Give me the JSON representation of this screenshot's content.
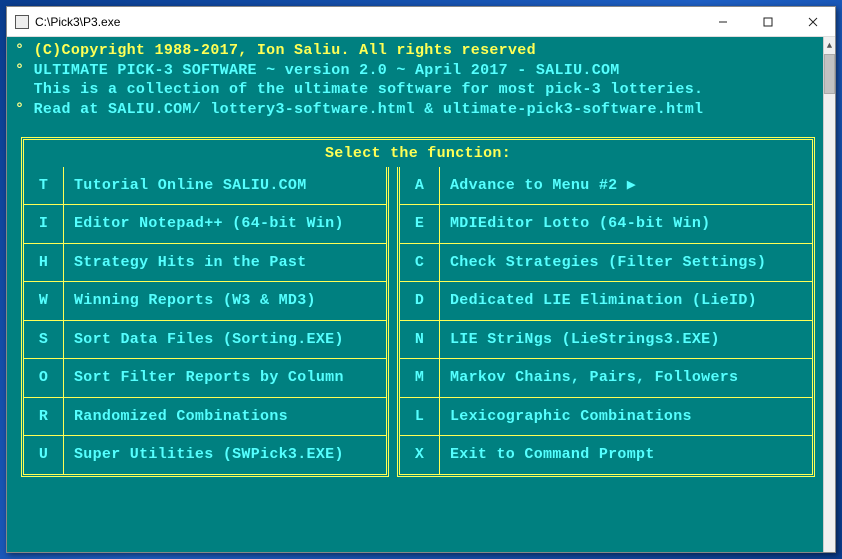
{
  "window": {
    "title": "C:\\Pick3\\P3.exe"
  },
  "header": {
    "line1": "(C)Copyright 1988-2017, Ion Saliu. All rights reserved",
    "line2": "ULTIMATE PICK-3 SOFTWARE ~ version 2.0 ~ April 2017 - SALIU.COM",
    "line3": "This is a collection of the ultimate software for most pick-3 lotteries.",
    "line4": "Read at SALIU.COM/ lottery3-software.html & ultimate-pick3-software.html"
  },
  "menu": {
    "title": "Select the function:",
    "left": [
      {
        "key": "T",
        "label": "Tutorial Online SALIU.COM"
      },
      {
        "key": "I",
        "label": "Editor Notepad++ (64-bit Win)"
      },
      {
        "key": "H",
        "label": "Strategy Hits in the Past"
      },
      {
        "key": "W",
        "label": "Winning Reports (W3 & MD3)"
      },
      {
        "key": "S",
        "label": "Sort Data Files (Sorting.EXE)"
      },
      {
        "key": "O",
        "label": "Sort Filter Reports by Column"
      },
      {
        "key": "R",
        "label": "Randomized Combinations"
      },
      {
        "key": "U",
        "label": "Super Utilities (SWPick3.EXE)"
      }
    ],
    "right": [
      {
        "key": "A",
        "label": "Advance to Menu #2 ▶"
      },
      {
        "key": "E",
        "label": "MDIEditor Lotto (64-bit Win)"
      },
      {
        "key": "C",
        "label": "Check Strategies (Filter Settings)"
      },
      {
        "key": "D",
        "label": "Dedicated LIE Elimination (LieID)"
      },
      {
        "key": "N",
        "label": "LIE StriNgs (LieStrings3.EXE)"
      },
      {
        "key": "M",
        "label": "Markov Chains, Pairs, Followers"
      },
      {
        "key": "L",
        "label": "Lexicographic Combinations"
      },
      {
        "key": "X",
        "label": "Exit to Command Prompt"
      }
    ]
  }
}
